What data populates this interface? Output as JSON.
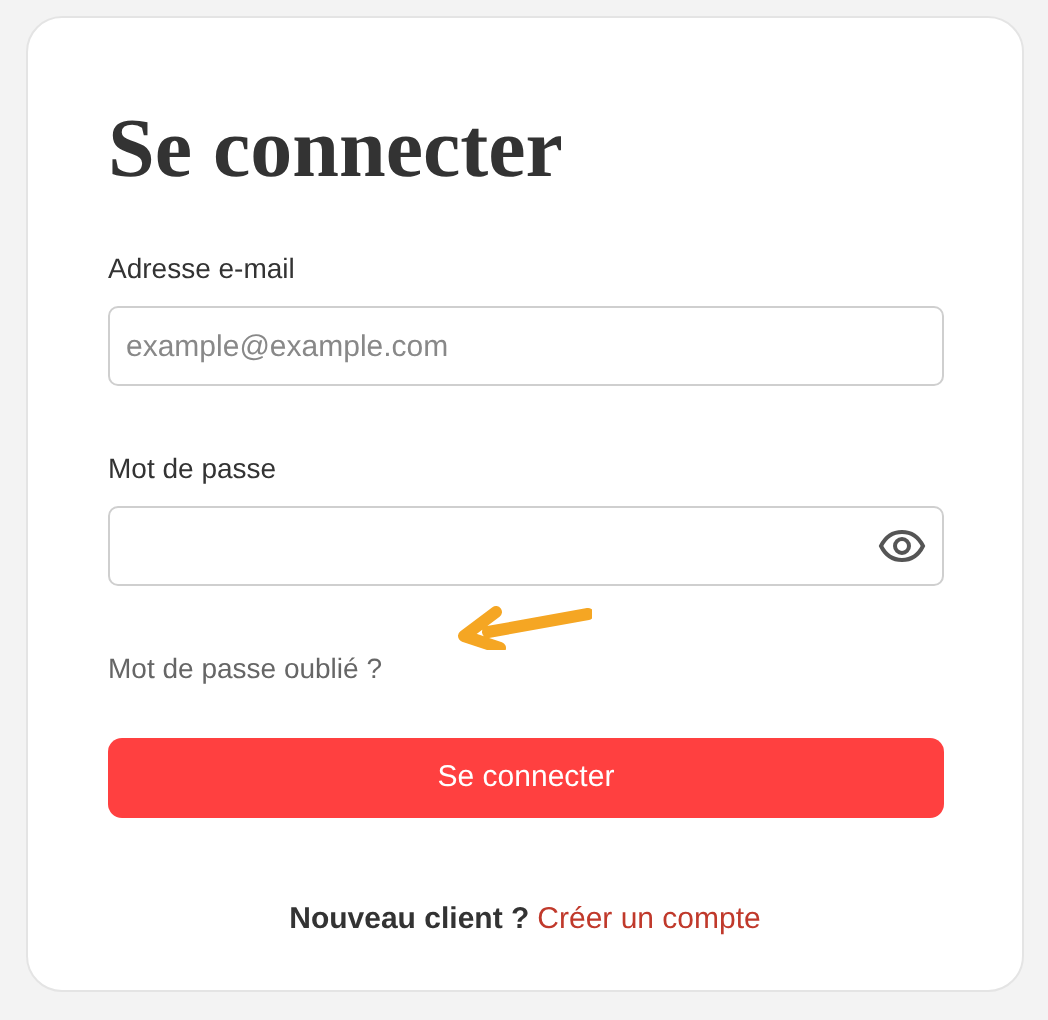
{
  "title": "Se connecter",
  "email": {
    "label": "Adresse e-mail",
    "placeholder": "example@example.com"
  },
  "password": {
    "label": "Mot de passe"
  },
  "forgot_link": "Mot de passe oublié ?",
  "submit": "Se connecter",
  "footer": {
    "text": "Nouveau client ?",
    "link": "Créer un compte"
  }
}
